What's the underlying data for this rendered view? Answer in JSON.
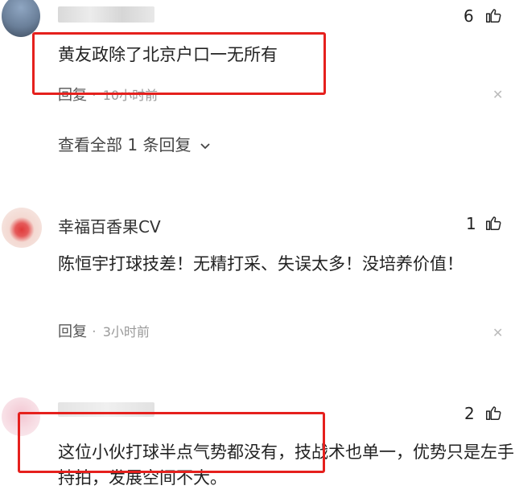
{
  "comments": [
    {
      "likes": "6",
      "text": "黄友政除了北京户口一无所有",
      "reply_label": "回复",
      "time": "10小时前",
      "expand_label": "查看全部 1 条回复"
    },
    {
      "username": "幸福百香果CV",
      "likes": "1",
      "text": "陈恒宇打球技差！无精打采、失误太多！没培养价值！",
      "reply_label": "回复",
      "time": "3小时前"
    },
    {
      "likes": "2",
      "text": "这位小伙打球半点气势都没有，技战术也单一，优势只是左手持拍，发展空间不大。"
    }
  ],
  "colors": {
    "highlight_box": "#e5201d"
  },
  "icons": {
    "like": "thumbs-up-icon",
    "close": "close-icon",
    "expand": "chevron-down-icon"
  }
}
